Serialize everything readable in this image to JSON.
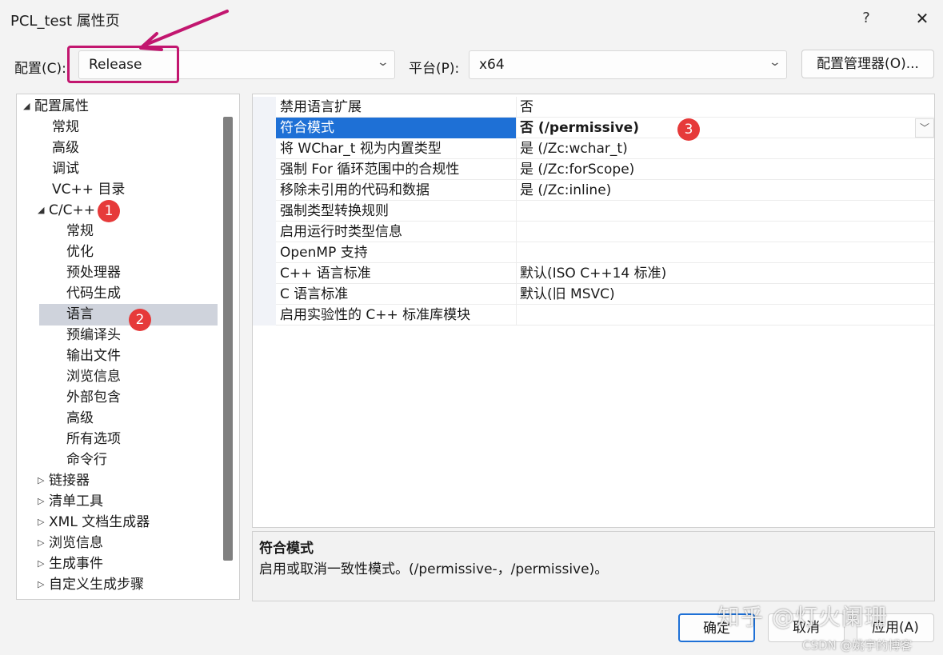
{
  "window": {
    "title": "PCL_test 属性页",
    "help": "?",
    "close": "✕"
  },
  "toolbar": {
    "config_label": "配置(C):",
    "config_value": "Release",
    "platform_label": "平台(P):",
    "platform_value": "x64",
    "manager_button": "配置管理器(O)..."
  },
  "tree": {
    "items": [
      {
        "label": "配置属性",
        "glyph": "◢",
        "level": 0
      },
      {
        "label": "常规",
        "glyph": "",
        "level": 1
      },
      {
        "label": "高级",
        "glyph": "",
        "level": 1
      },
      {
        "label": "调试",
        "glyph": "",
        "level": 1
      },
      {
        "label": "VC++ 目录",
        "glyph": "",
        "level": 1
      },
      {
        "label": "C/C++",
        "glyph": "◢",
        "level": 1
      },
      {
        "label": "常规",
        "glyph": "",
        "level": 2
      },
      {
        "label": "优化",
        "glyph": "",
        "level": 2
      },
      {
        "label": "预处理器",
        "glyph": "",
        "level": 2
      },
      {
        "label": "代码生成",
        "glyph": "",
        "level": 2
      },
      {
        "label": "语言",
        "glyph": "",
        "level": 2
      },
      {
        "label": "预编译头",
        "glyph": "",
        "level": 2
      },
      {
        "label": "输出文件",
        "glyph": "",
        "level": 2
      },
      {
        "label": "浏览信息",
        "glyph": "",
        "level": 2
      },
      {
        "label": "外部包含",
        "glyph": "",
        "level": 2
      },
      {
        "label": "高级",
        "glyph": "",
        "level": 2
      },
      {
        "label": "所有选项",
        "glyph": "",
        "level": 2
      },
      {
        "label": "命令行",
        "glyph": "",
        "level": 2
      },
      {
        "label": "链接器",
        "glyph": "▷",
        "level": 1
      },
      {
        "label": "清单工具",
        "glyph": "▷",
        "level": 1
      },
      {
        "label": "XML 文档生成器",
        "glyph": "▷",
        "level": 1
      },
      {
        "label": "浏览信息",
        "glyph": "▷",
        "level": 1
      },
      {
        "label": "生成事件",
        "glyph": "▷",
        "level": 1
      },
      {
        "label": "自定义生成步骤",
        "glyph": "▷",
        "level": 1
      }
    ]
  },
  "grid": {
    "rows": [
      {
        "name": "禁用语言扩展",
        "value": "否"
      },
      {
        "name": "符合模式",
        "value": "否 (/permissive)"
      },
      {
        "name": "将 WChar_t 视为内置类型",
        "value": "是 (/Zc:wchar_t)"
      },
      {
        "name": "强制 For 循环范围中的合规性",
        "value": "是 (/Zc:forScope)"
      },
      {
        "name": "移除未引用的代码和数据",
        "value": "是 (/Zc:inline)"
      },
      {
        "name": "强制类型转换规则",
        "value": ""
      },
      {
        "name": "启用运行时类型信息",
        "value": ""
      },
      {
        "name": "OpenMP 支持",
        "value": ""
      },
      {
        "name": "C++ 语言标准",
        "value": "默认(ISO C++14 标准)"
      },
      {
        "name": "C 语言标准",
        "value": "默认(旧 MSVC)"
      },
      {
        "name": "启用实验性的 C++ 标准库模块",
        "value": ""
      }
    ],
    "dropdown_glyph": "﹀"
  },
  "description": {
    "title": "符合模式",
    "text": "启用或取消一致性模式。(/permissive-，/permissive)。"
  },
  "buttons": {
    "ok": "确定",
    "cancel": "取消",
    "apply": "应用(A)"
  },
  "annotations": {
    "badge1": "1",
    "badge2": "2",
    "badge3": "3"
  },
  "watermarks": {
    "zhihu": "知乎 @灯火阑珊",
    "csdn": "CSDN @姚宇的博客"
  },
  "colors": {
    "selection": "#1e70d6",
    "tree_selection": "#cfd3dc",
    "annotation": "#c2166f",
    "badge": "#e63a3a"
  }
}
